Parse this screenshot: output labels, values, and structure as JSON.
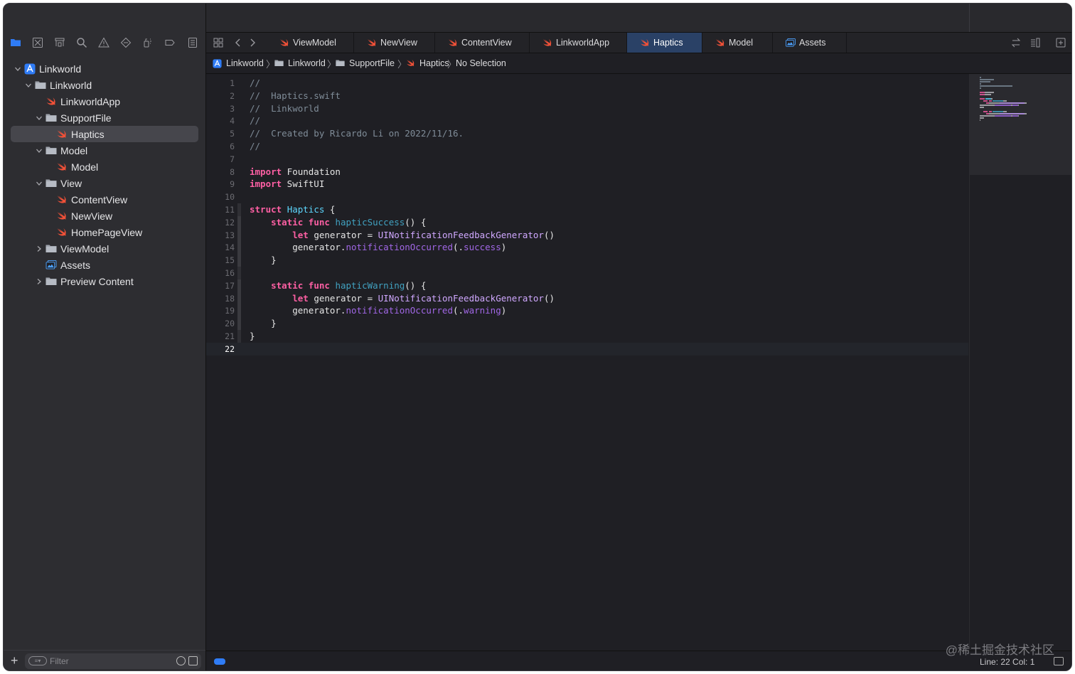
{
  "navigator": {
    "filter_placeholder": "Filter",
    "add_label": "+",
    "tree": [
      {
        "label": "Linkworld",
        "kind": "project",
        "level": 0,
        "disclosure": "open"
      },
      {
        "label": "Linkworld",
        "kind": "folder",
        "level": 1,
        "disclosure": "open"
      },
      {
        "label": "LinkworldApp",
        "kind": "swift",
        "level": 2,
        "disclosure": "none"
      },
      {
        "label": "SupportFile",
        "kind": "folder",
        "level": 2,
        "disclosure": "open"
      },
      {
        "label": "Haptics",
        "kind": "swift",
        "level": 3,
        "disclosure": "none",
        "selected": true
      },
      {
        "label": "Model",
        "kind": "folder",
        "level": 2,
        "disclosure": "open"
      },
      {
        "label": "Model",
        "kind": "swift",
        "level": 3,
        "disclosure": "none"
      },
      {
        "label": "View",
        "kind": "folder",
        "level": 2,
        "disclosure": "open"
      },
      {
        "label": "ContentView",
        "kind": "swift",
        "level": 3,
        "disclosure": "none"
      },
      {
        "label": "NewView",
        "kind": "swift",
        "level": 3,
        "disclosure": "none"
      },
      {
        "label": "HomePageView",
        "kind": "swift",
        "level": 3,
        "disclosure": "none"
      },
      {
        "label": "ViewModel",
        "kind": "folder",
        "level": 2,
        "disclosure": "closed"
      },
      {
        "label": "Assets",
        "kind": "assets",
        "level": 2,
        "disclosure": "none"
      },
      {
        "label": "Preview Content",
        "kind": "folder",
        "level": 2,
        "disclosure": "closed"
      }
    ]
  },
  "tabs": [
    {
      "label": "ViewModel",
      "kind": "swift"
    },
    {
      "label": "NewView",
      "kind": "swift"
    },
    {
      "label": "ContentView",
      "kind": "swift"
    },
    {
      "label": "LinkworldApp",
      "kind": "swift"
    },
    {
      "label": "Haptics",
      "kind": "swift",
      "active": true
    },
    {
      "label": "Model",
      "kind": "swift"
    },
    {
      "label": "Assets",
      "kind": "assets"
    }
  ],
  "breadcrumb": [
    {
      "label": "Linkworld",
      "kind": "project"
    },
    {
      "label": "Linkworld",
      "kind": "folder"
    },
    {
      "label": "SupportFile",
      "kind": "folder"
    },
    {
      "label": "Haptics",
      "kind": "swift"
    },
    {
      "label": "No Selection",
      "kind": "none"
    }
  ],
  "code": [
    [
      [
        "c",
        "//"
      ]
    ],
    [
      [
        "c",
        "//  Haptics.swift"
      ]
    ],
    [
      [
        "c",
        "//  Linkworld"
      ]
    ],
    [
      [
        "c",
        "//"
      ]
    ],
    [
      [
        "c",
        "//  Created by Ricardo Li on 2022/11/16."
      ]
    ],
    [
      [
        "c",
        "//"
      ]
    ],
    [],
    [
      [
        "k",
        "import"
      ],
      [
        "p",
        " Foundation"
      ]
    ],
    [
      [
        "k",
        "import"
      ],
      [
        "p",
        " SwiftUI"
      ]
    ],
    [],
    [
      [
        "k",
        "struct"
      ],
      [
        "p",
        " "
      ],
      [
        "t",
        "Haptics"
      ],
      [
        "p",
        " {"
      ]
    ],
    [
      [
        "p",
        "    "
      ],
      [
        "k",
        "static"
      ],
      [
        "p",
        " "
      ],
      [
        "k",
        "func"
      ],
      [
        "p",
        " "
      ],
      [
        "f",
        "hapticSuccess"
      ],
      [
        "p",
        "() {"
      ]
    ],
    [
      [
        "p",
        "        "
      ],
      [
        "k",
        "let"
      ],
      [
        "p",
        " generator = "
      ],
      [
        "s",
        "UINotificationFeedbackGenerator"
      ],
      [
        "p",
        "()"
      ]
    ],
    [
      [
        "p",
        "        generator."
      ],
      [
        "m",
        "notificationOccurred"
      ],
      [
        "p",
        "(."
      ],
      [
        "m",
        "success"
      ],
      [
        "p",
        ")"
      ]
    ],
    [
      [
        "p",
        "    }"
      ]
    ],
    [],
    [
      [
        "p",
        "    "
      ],
      [
        "k",
        "static"
      ],
      [
        "p",
        " "
      ],
      [
        "k",
        "func"
      ],
      [
        "p",
        " "
      ],
      [
        "f",
        "hapticWarning"
      ],
      [
        "p",
        "() {"
      ]
    ],
    [
      [
        "p",
        "        "
      ],
      [
        "k",
        "let"
      ],
      [
        "p",
        " generator = "
      ],
      [
        "s",
        "UINotificationFeedbackGenerator"
      ],
      [
        "p",
        "()"
      ]
    ],
    [
      [
        "p",
        "        generator."
      ],
      [
        "m",
        "notificationOccurred"
      ],
      [
        "p",
        "(."
      ],
      [
        "m",
        "warning"
      ],
      [
        "p",
        ")"
      ]
    ],
    [
      [
        "p",
        "    }"
      ]
    ],
    [
      [
        "p",
        "}"
      ]
    ],
    []
  ],
  "current_line": 22,
  "status": {
    "line_col": "Line: 22  Col: 1"
  },
  "watermark": "@稀土掘金技术社区",
  "colors": {
    "keyword": "#fc5fa3",
    "type": "#5dd8ff",
    "comment": "#7f8c98",
    "accent": "#2f7cf6",
    "swift": "#f05138"
  }
}
